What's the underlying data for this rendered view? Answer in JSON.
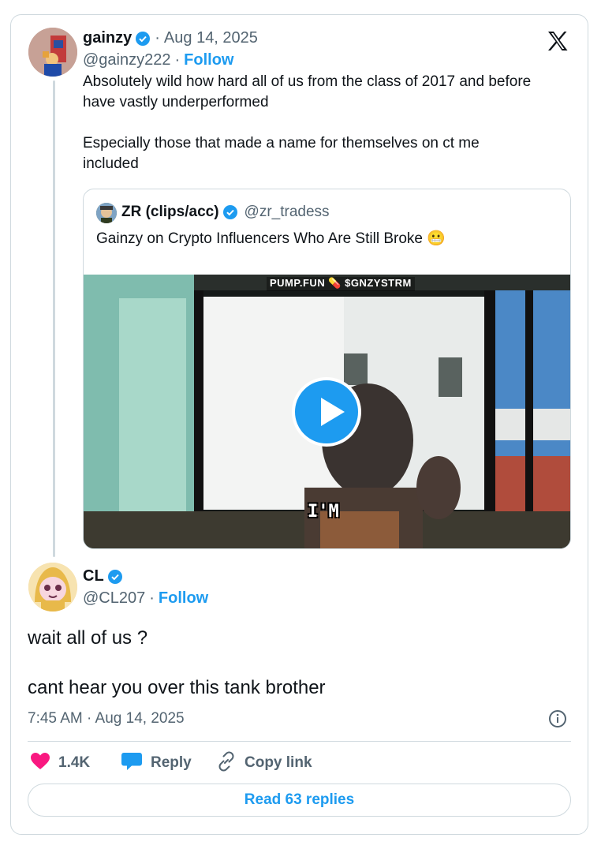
{
  "tweet": {
    "author_name": "gainzy",
    "author_handle": "@gainzy222",
    "date": "Aug 14, 2025",
    "follow_label": "Follow",
    "text": "Absolutely wild how hard all of us from the class of 2017 and before\nhave vastly underperformed\n\nEspecially those that made a name for themselves on ct me\nincluded"
  },
  "quote": {
    "author_name": "ZR (clips/acc)",
    "author_handle": "@zr_tradess",
    "text": "Gainzy on Crypto Influencers Who Are Still Broke 😬",
    "video": {
      "banner": "PUMP.FUN 💊 $GNZYSTRM",
      "caption": "I'M",
      "play_icon": "play-icon"
    }
  },
  "reply": {
    "author_name": "CL",
    "author_handle": "@CL207",
    "follow_label": "Follow",
    "text_line1": "wait all of us ?",
    "text_line2": "cant hear you over this tank brother",
    "timestamp": "7:45 AM · Aug 14, 2025"
  },
  "actions": {
    "like_count": "1.4K",
    "reply_label": "Reply",
    "copy_link_label": "Copy link",
    "read_replies_label": "Read 63 replies"
  },
  "colors": {
    "accent": "#1d9bf0",
    "like": "#f91880",
    "text": "#0f1419",
    "muted": "#536471",
    "border": "#cfd9de"
  },
  "icons": [
    "x-logo-icon",
    "verified-badge-icon",
    "play-icon",
    "info-icon",
    "heart-icon",
    "reply-bubble-icon",
    "link-icon"
  ]
}
